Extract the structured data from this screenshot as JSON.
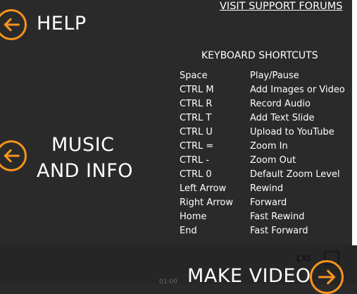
{
  "nav": {
    "help_label": "HELP",
    "music_label_line1": "MUSIC",
    "music_label_line2": "AND INFO",
    "make_video_label": "MAKE VIDEO"
  },
  "support_link": "VISIT SUPPORT FORUMS",
  "shortcuts": {
    "title": "KEYBOARD SHORTCUTS",
    "rows": [
      {
        "key": "Space",
        "action": "Play/Pause"
      },
      {
        "key": "CTRL M",
        "action": "Add Images or Video"
      },
      {
        "key": "CTRL R",
        "action": "Record Audio"
      },
      {
        "key": "CTRL T",
        "action": "Add Text Slide"
      },
      {
        "key": "CTRL U",
        "action": "Upload to YouTube"
      },
      {
        "key": "CTRL =",
        "action": "Zoom In"
      },
      {
        "key": "CTRL -",
        "action": "Zoom Out"
      },
      {
        "key": "CTRL 0",
        "action": "Default Zoom Level"
      },
      {
        "key": "Left Arrow",
        "action": "Rewind"
      },
      {
        "key": "Right Arrow",
        "action": "Forward"
      },
      {
        "key": "Home",
        "action": "Fast Rewind"
      },
      {
        "key": "End",
        "action": "Fast Forward"
      }
    ]
  },
  "bottom_bar": {
    "time_text": "01:00"
  },
  "colors": {
    "accent": "#f7941d",
    "background": "#2a2a2a",
    "text": "#ffffff"
  },
  "icons": {
    "help": "arrow-left-circle-icon",
    "music": "arrow-left-circle-icon",
    "make_video": "arrow-right-circle-icon",
    "controller": "gamepad-icon",
    "window": "window-icon"
  }
}
